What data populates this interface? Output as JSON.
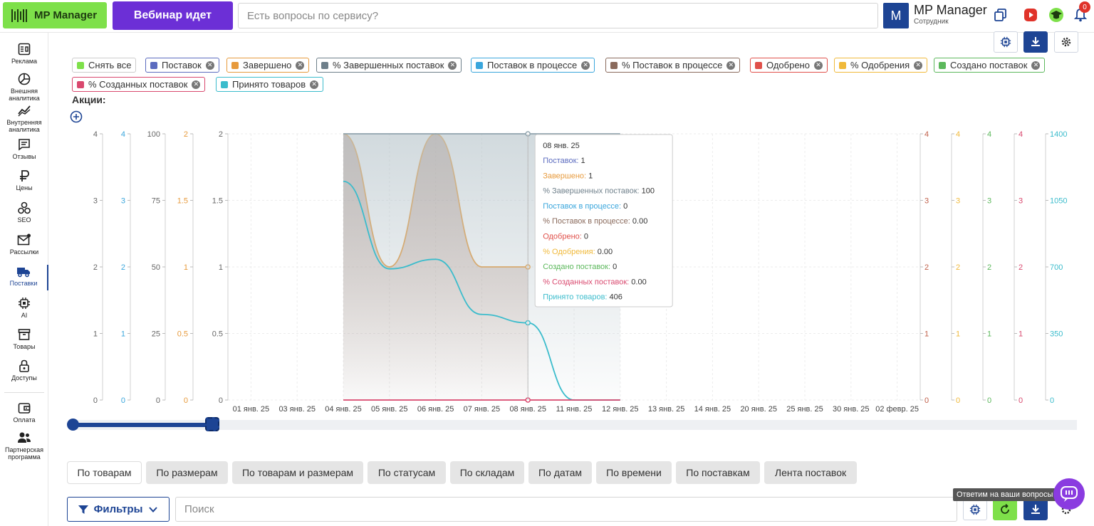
{
  "header": {
    "logo_label": "MP Manager",
    "webinar_label": "Вебинар идет",
    "question_placeholder": "Есть вопросы по сервису?",
    "avatar_letter": "M",
    "account_name": "MP Manager",
    "account_role": "Сотрудник",
    "notification_count": "0"
  },
  "sidebar": {
    "items": [
      {
        "label": "Реклама",
        "icon": "ad-icon"
      },
      {
        "label": "Внешняя аналитика",
        "icon": "external-analytics-icon"
      },
      {
        "label": "Внутренняя аналитика",
        "icon": "internal-analytics-icon"
      },
      {
        "label": "Отзывы",
        "icon": "reviews-icon"
      },
      {
        "label": "Цены",
        "icon": "ruble-icon"
      },
      {
        "label": "SEO",
        "icon": "seo-icon"
      },
      {
        "label": "Рассылки",
        "icon": "mail-icon"
      },
      {
        "label": "Поставки",
        "icon": "truck-icon"
      },
      {
        "label": "AI",
        "icon": "chip-icon"
      },
      {
        "label": "Товары",
        "icon": "box-icon"
      },
      {
        "label": "Доступы",
        "icon": "lock-icon"
      },
      {
        "label": "Оплата",
        "icon": "wallet-icon"
      },
      {
        "label": "Партнерская программа",
        "icon": "partners-icon"
      }
    ]
  },
  "legend_chips": [
    {
      "label": "Снять все",
      "color": "#7ee04a"
    },
    {
      "label": "Поставок",
      "color": "#5b6bbf"
    },
    {
      "label": "Завершено",
      "color": "#e79a3c"
    },
    {
      "label": "% Завершенных поставок",
      "color": "#6e7f8a"
    },
    {
      "label": "Поставок в процессе",
      "color": "#3aa6dc"
    },
    {
      "label": "% Поставок в процессе",
      "color": "#8a6a5c"
    },
    {
      "label": "Одобрено",
      "color": "#e0504a"
    },
    {
      "label": "% Одобрения",
      "color": "#f0b93a"
    },
    {
      "label": "Создано поставок",
      "color": "#5cb85c"
    },
    {
      "label": "% Созданных поставок",
      "color": "#d9486e"
    },
    {
      "label": "Принято товаров",
      "color": "#3bbccc"
    }
  ],
  "promo": {
    "title": "Акции:"
  },
  "chart_data": {
    "type": "line",
    "x": [
      "01 янв. 25",
      "03 янв. 25",
      "04 янв. 25",
      "05 янв. 25",
      "06 янв. 25",
      "07 янв. 25",
      "08 янв. 25",
      "11 янв. 25",
      "12 янв. 25",
      "13 янв. 25",
      "14 янв. 25",
      "20 янв. 25",
      "25 янв. 25",
      "30 янв. 25",
      "02 февр. 25"
    ],
    "left_axes": [
      {
        "ticks": [
          "4",
          "3",
          "2",
          "1",
          "0"
        ],
        "color": "#666666"
      },
      {
        "ticks": [
          "4",
          "3",
          "2",
          "1",
          "0"
        ],
        "color": "#3aa6dc"
      },
      {
        "ticks": [
          "100",
          "75",
          "50",
          "25",
          "0"
        ],
        "color": "#666666"
      },
      {
        "ticks": [
          "2",
          "1.5",
          "1",
          "0.5",
          "0"
        ],
        "color": "#e79a3c"
      },
      {
        "ticks": [
          "2",
          "1.5",
          "1",
          "0.5",
          "0"
        ],
        "color": "#666666"
      }
    ],
    "right_axes": [
      {
        "ticks": [
          "4",
          "3",
          "2",
          "1",
          "0"
        ],
        "color": "#c0604a"
      },
      {
        "ticks": [
          "4",
          "3",
          "2",
          "1",
          "0"
        ],
        "color": "#f0b93a"
      },
      {
        "ticks": [
          "4",
          "3",
          "2",
          "1",
          "0"
        ],
        "color": "#5cb85c"
      },
      {
        "ticks": [
          "4",
          "3",
          "2",
          "1",
          "0"
        ],
        "color": "#d9486e"
      },
      {
        "ticks": [
          "1400",
          "1050",
          "700",
          "350",
          "0"
        ],
        "color": "#3bbccc"
      }
    ],
    "series": [
      {
        "name": "Завершено",
        "color": "#e79a3c",
        "x_index": [
          2,
          3,
          4,
          5,
          6
        ],
        "values": [
          2,
          1,
          2,
          1,
          1
        ],
        "ylim": [
          0,
          2
        ]
      },
      {
        "name": "% Завершенных поставок",
        "color": "#8fa3ad",
        "x_index": [
          2,
          3,
          4,
          5,
          6,
          7,
          8
        ],
        "values": [
          100,
          100,
          100,
          100,
          100,
          100,
          100
        ],
        "ylim": [
          0,
          100
        ]
      },
      {
        "name": "Принято товаров",
        "color": "#3bbccc",
        "x_index": [
          2,
          3,
          4,
          5,
          6,
          7,
          8
        ],
        "values": [
          1150,
          690,
          740,
          450,
          406,
          0,
          0
        ],
        "ylim": [
          0,
          1400
        ]
      },
      {
        "name": "Одобрено",
        "color": "#d9486e",
        "x_index": [
          2,
          3,
          4,
          5,
          6,
          7,
          8
        ],
        "values": [
          0,
          0,
          0,
          0,
          0,
          0,
          0
        ],
        "ylim": [
          0,
          4
        ]
      }
    ],
    "grid": true,
    "tooltip": {
      "title": "08 янв. 25",
      "rows": [
        {
          "label": "Поставок:",
          "value": "1",
          "color": "#5b6bbf"
        },
        {
          "label": "Завершено:",
          "value": "1",
          "color": "#e79a3c"
        },
        {
          "label": "% Завершенных поставок:",
          "value": "100",
          "color": "#6e7f8a"
        },
        {
          "label": "Поставок в процессе:",
          "value": "0",
          "color": "#3aa6dc"
        },
        {
          "label": "% Поставок в процессе:",
          "value": "0.00",
          "color": "#8a6a5c"
        },
        {
          "label": "Одобрено:",
          "value": "0",
          "color": "#e0504a"
        },
        {
          "label": "% Одобрения:",
          "value": "0.00",
          "color": "#f0b93a"
        },
        {
          "label": "Создано поставок:",
          "value": "0",
          "color": "#5cb85c"
        },
        {
          "label": "% Созданных поставок:",
          "value": "0.00",
          "color": "#d9486e"
        },
        {
          "label": "Принято товаров:",
          "value": "406",
          "color": "#3bbccc"
        }
      ]
    }
  },
  "tabs": [
    "По товарам",
    "По размерам",
    "По товарам и размерам",
    "По статусам",
    "По складам",
    "По датам",
    "По времени",
    "По поставкам",
    "Лента поставок"
  ],
  "filters": {
    "label": "Фильтры",
    "search_placeholder": "Поиск"
  },
  "help": {
    "tooltip": "Ответим на ваши вопросы"
  }
}
